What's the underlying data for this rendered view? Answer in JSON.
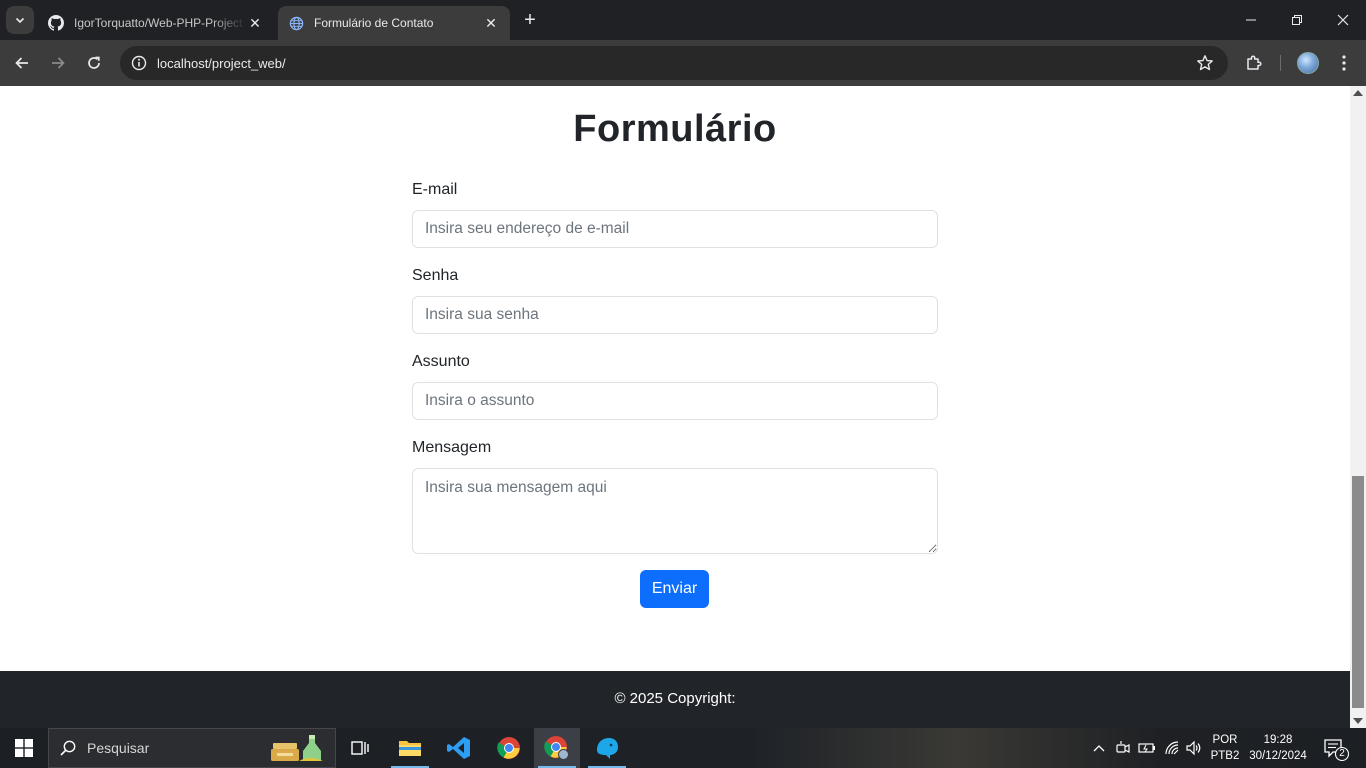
{
  "browser": {
    "tabs": [
      {
        "title": "IgorTorquatto/Web-PHP-Project",
        "favicon": "github-icon",
        "active": false
      },
      {
        "title": "Formulário de Contato",
        "favicon": "globe-icon",
        "active": true
      }
    ],
    "url": "localhost/project_web/"
  },
  "page": {
    "title": "Formulário",
    "fields": [
      {
        "label": "E-mail",
        "placeholder": "Insira seu endereço de e-mail",
        "type": "email"
      },
      {
        "label": "Senha",
        "placeholder": "Insira sua senha",
        "type": "password"
      },
      {
        "label": "Assunto",
        "placeholder": "Insira o assunto",
        "type": "text"
      },
      {
        "label": "Mensagem",
        "placeholder": "Insira sua mensagem aqui",
        "type": "textarea"
      }
    ],
    "submit_label": "Enviar",
    "footer_text": "© 2025 Copyright:"
  },
  "taskbar": {
    "search_placeholder": "Pesquisar",
    "language_line1": "POR",
    "language_line2": "PTB2",
    "time": "19:28",
    "date": "30/12/2024",
    "notification_count": "2"
  },
  "colors": {
    "primary_button": "#0d6efd",
    "footer_bg": "#212529",
    "chrome_dark": "#202124"
  }
}
